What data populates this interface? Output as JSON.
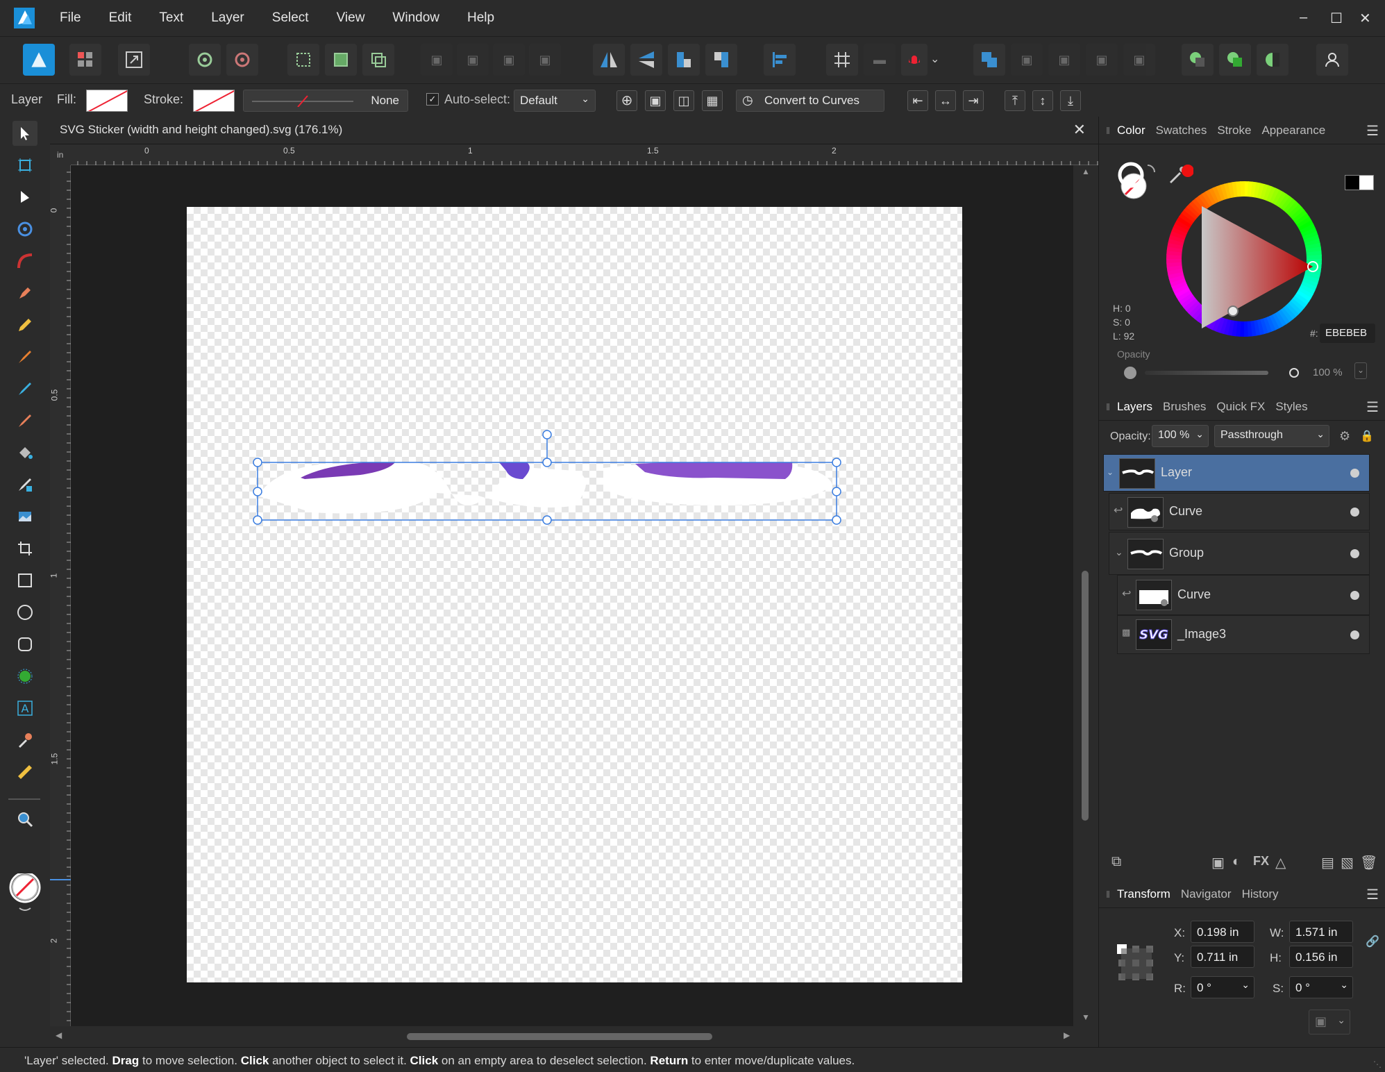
{
  "menu": [
    "File",
    "Edit",
    "Text",
    "Layer",
    "Select",
    "View",
    "Window",
    "Help"
  ],
  "context": {
    "layer_label": "Layer",
    "fill_label": "Fill:",
    "stroke_label": "Stroke:",
    "stroke_value": "None",
    "autoselect_label": "Auto-select:",
    "autoselect_value": "Default",
    "convert_label": "Convert to Curves"
  },
  "document": {
    "title": "SVG Sticker (width and height changed).svg (176.1%)",
    "ruler_unit": "in",
    "h_ticks": [
      "0",
      "0.5",
      "1",
      "1.5",
      "2"
    ],
    "v_ticks": [
      "0",
      "0.5",
      "1",
      "1.5",
      "2"
    ]
  },
  "color_panel": {
    "tabs": [
      "Color",
      "Swatches",
      "Stroke",
      "Appearance"
    ],
    "h": "H: 0",
    "s": "S: 0",
    "l": "L: 92",
    "hex_prefix": "#:",
    "hex": "EBEBEB",
    "opacity_label": "Opacity",
    "opacity_value": "100 %"
  },
  "layers_panel": {
    "tabs": [
      "Layers",
      "Brushes",
      "Quick FX",
      "Styles"
    ],
    "opacity_label": "Opacity:",
    "opacity_value": "100 %",
    "blend_mode": "Passthrough",
    "layers": [
      {
        "name": "Layer"
      },
      {
        "name": "Curve"
      },
      {
        "name": "Group"
      },
      {
        "name": "Curve"
      },
      {
        "name": "_Image3",
        "thumb": "SVG"
      }
    ]
  },
  "transform_panel": {
    "tabs": [
      "Transform",
      "Navigator",
      "History"
    ],
    "x_label": "X:",
    "x": "0.198 in",
    "y_label": "Y:",
    "y": "0.711 in",
    "w_label": "W:",
    "w": "1.571 in",
    "h_label": "H:",
    "h": "0.156 in",
    "r_label": "R:",
    "r": "0 °",
    "s_label": "S:",
    "s": "0 °"
  },
  "status": {
    "p1": "'Layer' selected. ",
    "b1": "Drag",
    "p2": " to move selection. ",
    "b2": "Click",
    "p3": " another object to select it. ",
    "b3": "Click",
    "p4": " on an empty area to deselect selection. ",
    "b4": "Return",
    "p5": " to enter move/duplicate values."
  },
  "colors": {
    "accent": "#4a90e2",
    "selection_row": "#4a6fa0",
    "canvas_bg": "#1f1f1f",
    "ui_bg": "#2b2b2b"
  }
}
